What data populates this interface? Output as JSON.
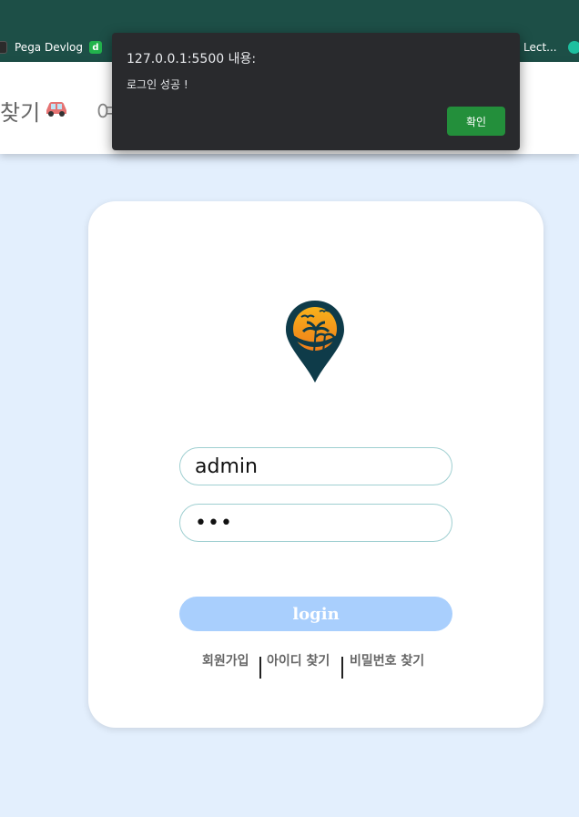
{
  "browser": {
    "bookmarks": [
      {
        "label": "Pega Devlog",
        "icon": "pega-favicon"
      },
      {
        "label": "",
        "icon_letter": "d"
      },
      {
        "label": "Lect...",
        "icon": "lecture-favicon"
      },
      {
        "label": "",
        "icon": "globe-favicon"
      }
    ]
  },
  "header": {
    "nav_find": "찾기",
    "nav_second": "여"
  },
  "alert": {
    "title": "127.0.0.1:5500 내용:",
    "message": "로그인 성공 !",
    "ok_label": "확인",
    "ok_color": "#238f3b"
  },
  "login": {
    "username_value": "admin",
    "password_value": "•••",
    "button_label": "login",
    "button_color": "#a9cffd",
    "links": {
      "signup": "회원가입",
      "find_id": "아이디 찾기",
      "find_password": "비밀번호 찾기"
    }
  },
  "colors": {
    "page_background": "#e3effd",
    "chrome": "#1d4f47",
    "input_border": "#9fcfd1"
  }
}
